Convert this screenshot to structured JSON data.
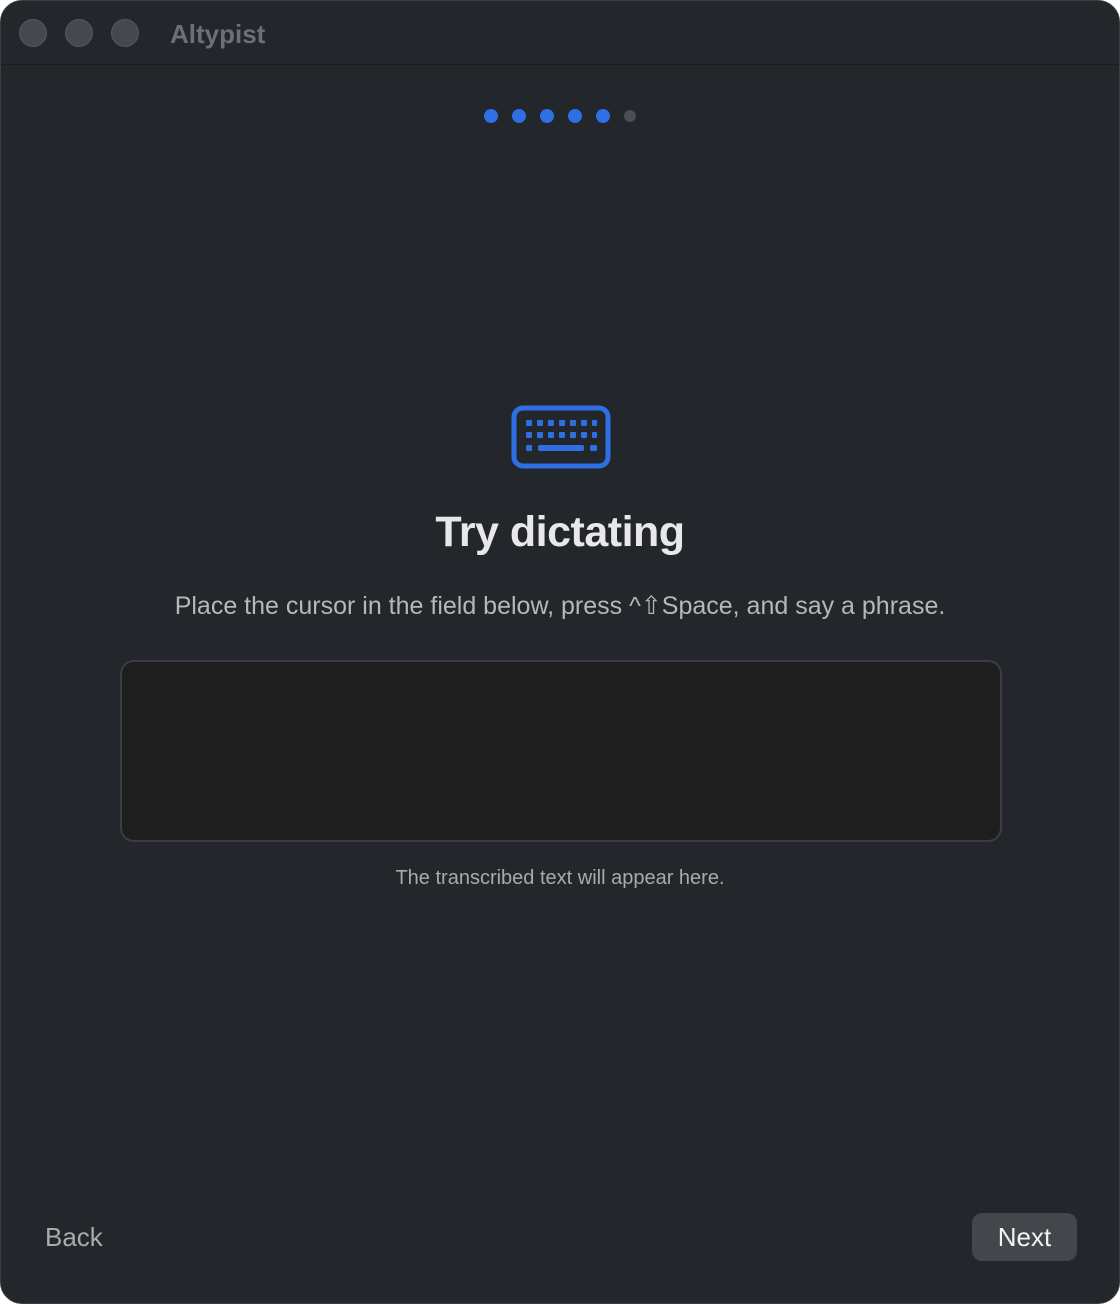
{
  "window": {
    "title": "Altypist"
  },
  "progress": {
    "total_steps": 6,
    "current_step": 5,
    "active_color": "#2f6fe4",
    "inactive_color": "#4a4d52"
  },
  "main": {
    "icon": "keyboard-icon",
    "heading": "Try dictating",
    "subtitle": "Place the cursor in the field below, press ^⇧Space, and say a phrase.",
    "field_value": "",
    "hint": "The transcribed text will appear here."
  },
  "footer": {
    "back_label": "Back",
    "next_label": "Next"
  }
}
